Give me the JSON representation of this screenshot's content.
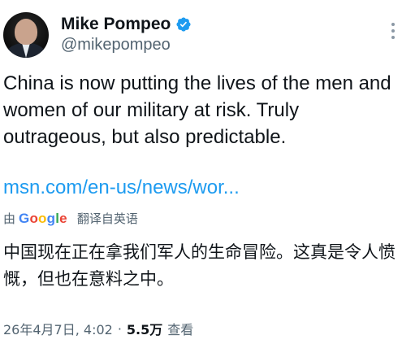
{
  "author": {
    "display_name": "Mike Pompeo",
    "handle": "@mikepompeo",
    "verified": true,
    "verified_color": "#1d9bf0",
    "avatar_icon": "profile-photo"
  },
  "tweet": {
    "text": "China is now putting the lives of the men and women of our military at risk. Truly outrageous, but also predictable.",
    "link_text": "msn.com/en-us/news/wor..."
  },
  "translation": {
    "prefix": "由",
    "provider": "Google",
    "label": "翻译自英语",
    "text": "中国现在正在拿我们军人的生命冒险。这真是令人愤慨，但也在意料之中。"
  },
  "meta": {
    "timestamp": "26年4月7日, 4:02",
    "separator": "·",
    "views_count": "5.5万",
    "views_label": "查看"
  },
  "colors": {
    "text_primary": "#0f1419",
    "text_secondary": "#536471",
    "link": "#1d9bf0"
  }
}
